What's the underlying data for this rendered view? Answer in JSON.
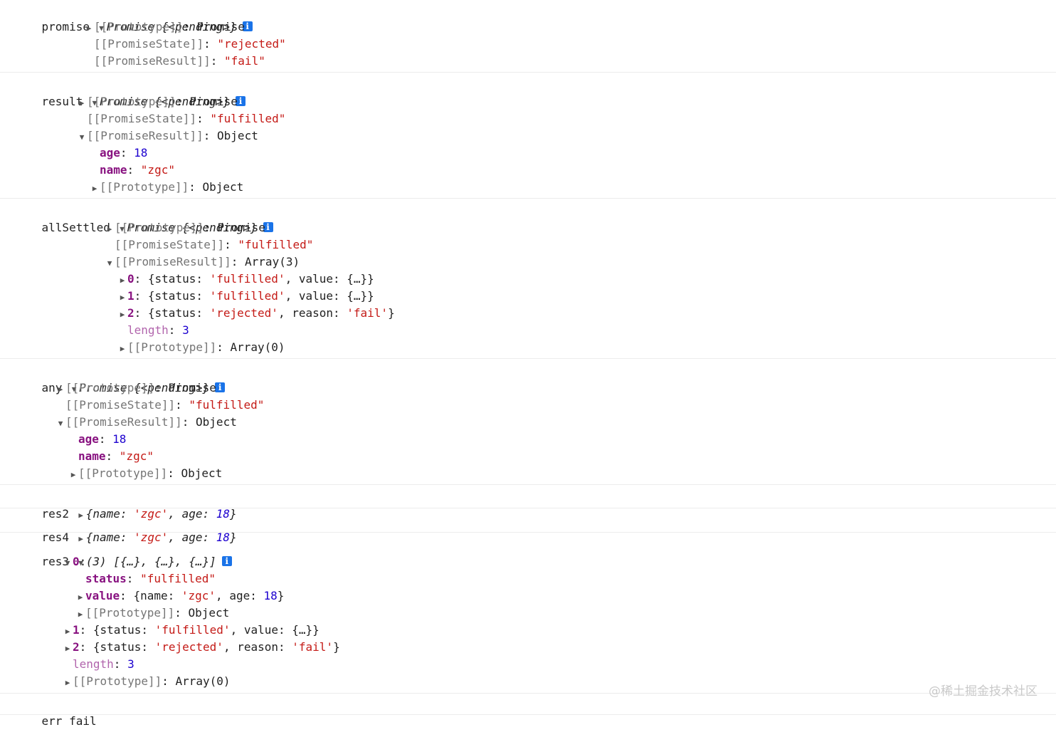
{
  "entries": [
    {
      "label": "promise",
      "summary": {
        "type": "Promise",
        "state": "{<pending>}"
      },
      "rows": [
        {
          "tri": "collapsed",
          "key": "[[Prototype]]",
          "value": "Promise"
        },
        {
          "tri": "none",
          "key": "[[PromiseState]]",
          "value": "\"rejected\""
        },
        {
          "tri": "none",
          "key": "[[PromiseResult]]",
          "value": "\"fail\""
        }
      ]
    },
    {
      "label": "result",
      "summary": {
        "type": "Promise",
        "state": "{<pending>}"
      },
      "rows": [
        {
          "tri": "collapsed",
          "key": "[[Prototype]]",
          "value": "Promise"
        },
        {
          "tri": "none",
          "key": "[[PromiseState]]",
          "value": "\"fulfilled\""
        },
        {
          "tri": "expanded",
          "key": "[[PromiseResult]]",
          "value": "Object"
        },
        {
          "tri": "none",
          "key": "age",
          "value": "18"
        },
        {
          "tri": "none",
          "key": "name",
          "value": "\"zgc\""
        },
        {
          "tri": "collapsed",
          "key": "[[Prototype]]",
          "value": "Object"
        }
      ]
    },
    {
      "label": "allSettled",
      "summary": {
        "type": "Promise",
        "state": "{<pending>}"
      },
      "rows": [
        {
          "tri": "collapsed",
          "key": "[[Prototype]]",
          "value": "Promise"
        },
        {
          "tri": "none",
          "key": "[[PromiseState]]",
          "value": "\"fulfilled\""
        },
        {
          "tri": "expanded",
          "key": "[[PromiseResult]]",
          "value": "Array(3)"
        },
        {
          "tri": "collapsed",
          "key": "0",
          "open": "{status: ",
          "status": "'fulfilled'",
          "mid": ", value: ",
          "tail": "{…}}"
        },
        {
          "tri": "collapsed",
          "key": "1",
          "open": "{status: ",
          "status": "'fulfilled'",
          "mid": ", value: ",
          "tail": "{…}}"
        },
        {
          "tri": "collapsed",
          "key": "2",
          "open": "{status: ",
          "status": "'rejected'",
          "mid": ", reason: ",
          "reason": "'fail'",
          "tail": "}"
        },
        {
          "tri": "none",
          "key": "length",
          "value": "3"
        },
        {
          "tri": "collapsed",
          "key": "[[Prototype]]",
          "value": "Array(0)"
        }
      ]
    },
    {
      "label": "any",
      "summary": {
        "type": "Promise",
        "state": "{<pending>}"
      },
      "rows": [
        {
          "tri": "collapsed",
          "key": "[[Prototype]]",
          "value": "Promise"
        },
        {
          "tri": "none",
          "key": "[[PromiseState]]",
          "value": "\"fulfilled\""
        },
        {
          "tri": "expanded",
          "key": "[[PromiseResult]]",
          "value": "Object"
        },
        {
          "tri": "none",
          "key": "age",
          "value": "18"
        },
        {
          "tri": "none",
          "key": "name",
          "value": "\"zgc\""
        },
        {
          "tri": "collapsed",
          "key": "[[Prototype]]",
          "value": "Object"
        }
      ]
    },
    {
      "label": "res2",
      "summary": {
        "open": "{name: ",
        "name": "'zgc'",
        "mid": ", age: ",
        "age": "18",
        "close": "}"
      }
    },
    {
      "label": "res4",
      "summary": {
        "open": "{name: ",
        "name": "'zgc'",
        "mid": ", age: ",
        "age": "18",
        "close": "}"
      }
    },
    {
      "label": "res3",
      "summary": {
        "text": "(3) [{…}, {…}, {…}]"
      },
      "rows": [
        {
          "tri": "expanded",
          "key": "0",
          "value": ""
        },
        {
          "tri": "none",
          "key": "status",
          "value": "\"fulfilled\""
        },
        {
          "tri": "collapsed",
          "key": "value",
          "open": "{name: ",
          "name": "'zgc'",
          "mid": ", age: ",
          "age": "18",
          "close": "}"
        },
        {
          "tri": "collapsed",
          "key": "[[Prototype]]",
          "value": "Object"
        },
        {
          "tri": "collapsed",
          "key": "1",
          "open": "{status: ",
          "status": "'fulfilled'",
          "mid": ", value: ",
          "tail": "{…}}"
        },
        {
          "tri": "collapsed",
          "key": "2",
          "open": "{status: ",
          "status": "'rejected'",
          "mid": ", reason: ",
          "reason": "'fail'",
          "tail": "}"
        },
        {
          "tri": "none",
          "key": "length",
          "value": "3"
        },
        {
          "tri": "collapsed",
          "key": "[[Prototype]]",
          "value": "Array(0)"
        }
      ]
    },
    {
      "label": "err",
      "message": "fail"
    }
  ],
  "icons": {
    "expanded": "triangle-down-icon",
    "collapsed": "triangle-right-icon",
    "info": "info-icon"
  },
  "watermark": "@稀土掘金技术社区"
}
